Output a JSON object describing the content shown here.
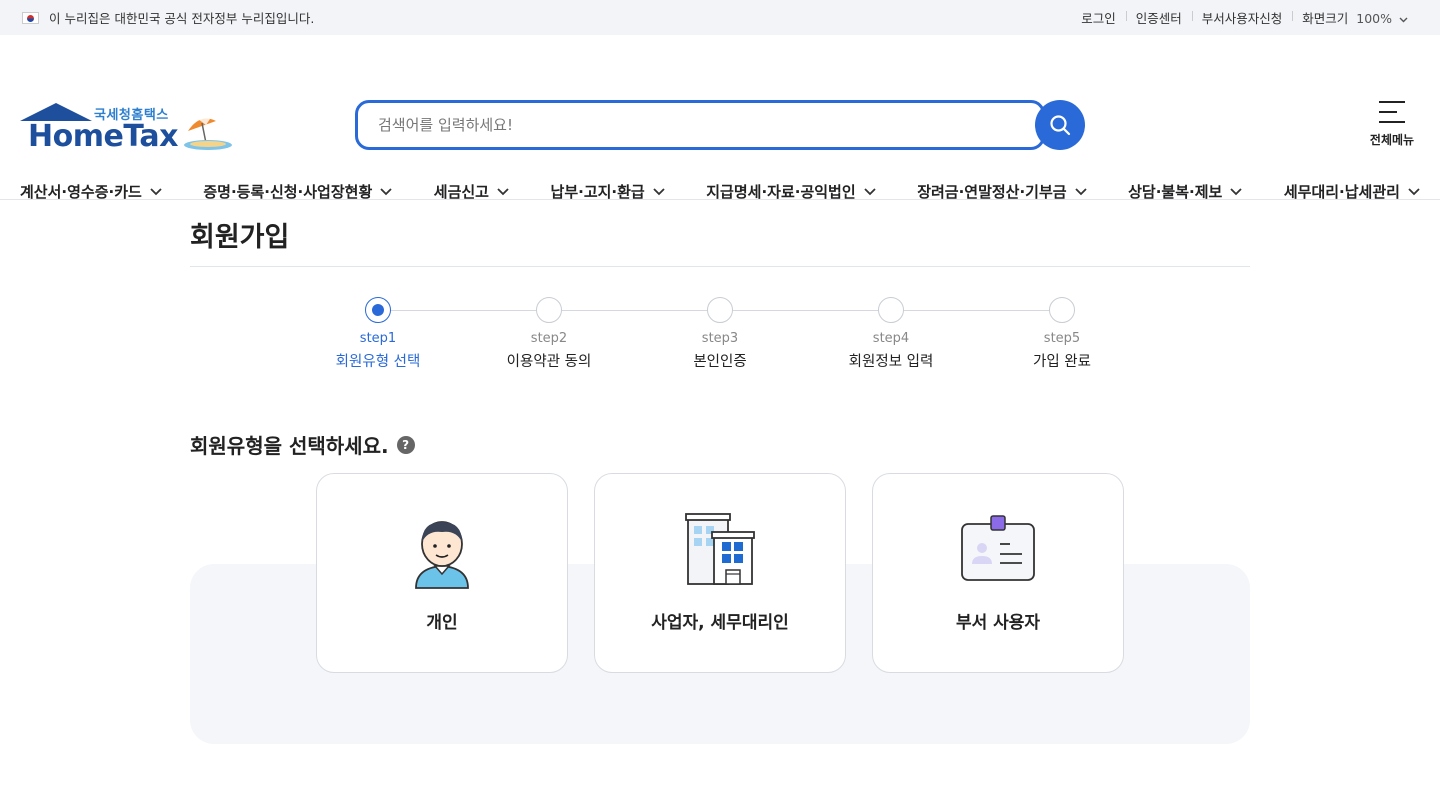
{
  "topbar": {
    "notice": "이 누리집은 대한민국 공식 전자정부 누리집입니다.",
    "links": [
      "로그인",
      "인증센터",
      "부서사용자신청"
    ],
    "zoom_label": "화면크기",
    "zoom_value": "100%"
  },
  "header": {
    "logo_sub": "국세청홈택스",
    "logo_main": "HomeTax",
    "search_placeholder": "검색어를 입력하세요!",
    "all_menu_label": "전체메뉴"
  },
  "nav": {
    "items": [
      "계산서·영수증·카드",
      "증명·등록·신청·사업장현황",
      "세금신고",
      "납부·고지·환급",
      "지급명세·자료·공익법인",
      "장려금·연말정산·기부금",
      "상담·불복·제보",
      "세무대리·납세관리"
    ]
  },
  "page": {
    "title": "회원가입",
    "steps": [
      {
        "num": "step1",
        "label": "회원유형 선택"
      },
      {
        "num": "step2",
        "label": "이용약관 동의"
      },
      {
        "num": "step3",
        "label": "본인인증"
      },
      {
        "num": "step4",
        "label": "회원정보 입력"
      },
      {
        "num": "step5",
        "label": "가입 완료"
      }
    ],
    "active_step": 1,
    "section_title": "회원유형을 선택하세요.",
    "help_glyph": "?",
    "cards": [
      {
        "label": "개인",
        "icon": "person-icon"
      },
      {
        "label": "사업자, 세무대리인",
        "icon": "building-icon"
      },
      {
        "label": "부서 사용자",
        "icon": "id-card-icon"
      }
    ]
  },
  "colors": {
    "accent": "#2a6ad8",
    "logo_blue": "#1d4f9c"
  }
}
